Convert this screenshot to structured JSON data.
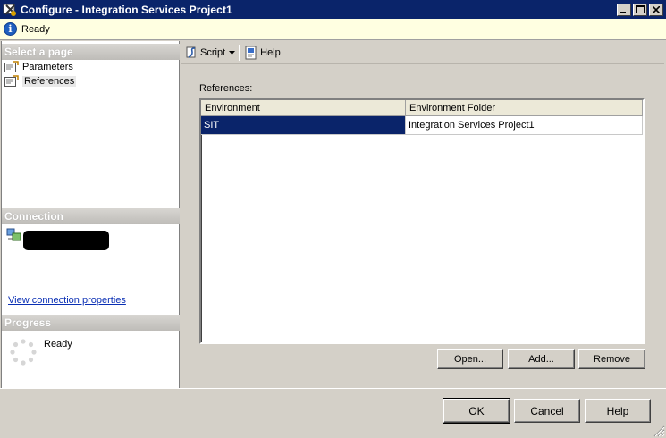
{
  "window": {
    "title": "Configure - Integration Services Project1",
    "controls": {
      "minimize": "minimize-icon",
      "maximize": "maximize-icon",
      "close": "close-icon"
    }
  },
  "status": {
    "icon": "info-icon",
    "text": "Ready"
  },
  "left_pane": {
    "select_page_header": "Select a page",
    "pages": [
      {
        "label": "Parameters",
        "icon": "page-icon",
        "selected": false
      },
      {
        "label": "References",
        "icon": "page-icon",
        "selected": true
      }
    ],
    "connection_header": "Connection",
    "connection_icon": "server-connection-icon",
    "connection_value_redacted": true,
    "view_connection_link": "View connection properties",
    "progress_header": "Progress",
    "progress_icon": "spinner-icon",
    "progress_text": "Ready"
  },
  "toolbar": {
    "script_label": "Script",
    "script_icon": "script-icon",
    "help_label": "Help",
    "help_icon": "help-icon"
  },
  "references": {
    "label": "References:",
    "columns": [
      "Environment",
      "Environment Folder"
    ],
    "rows": [
      {
        "environment": "SIT",
        "folder": "Integration Services Project1",
        "selected": true
      }
    ]
  },
  "grid_buttons": {
    "open": "Open...",
    "add": "Add...",
    "remove": "Remove"
  },
  "dialog_buttons": {
    "ok": "OK",
    "cancel": "Cancel",
    "help": "Help"
  },
  "colors": {
    "titlebar": "#0a246a",
    "selection": "#0a246a",
    "status_bg": "#ffffe1",
    "link": "#0a2fb4",
    "chrome": "#d4d0c8"
  }
}
